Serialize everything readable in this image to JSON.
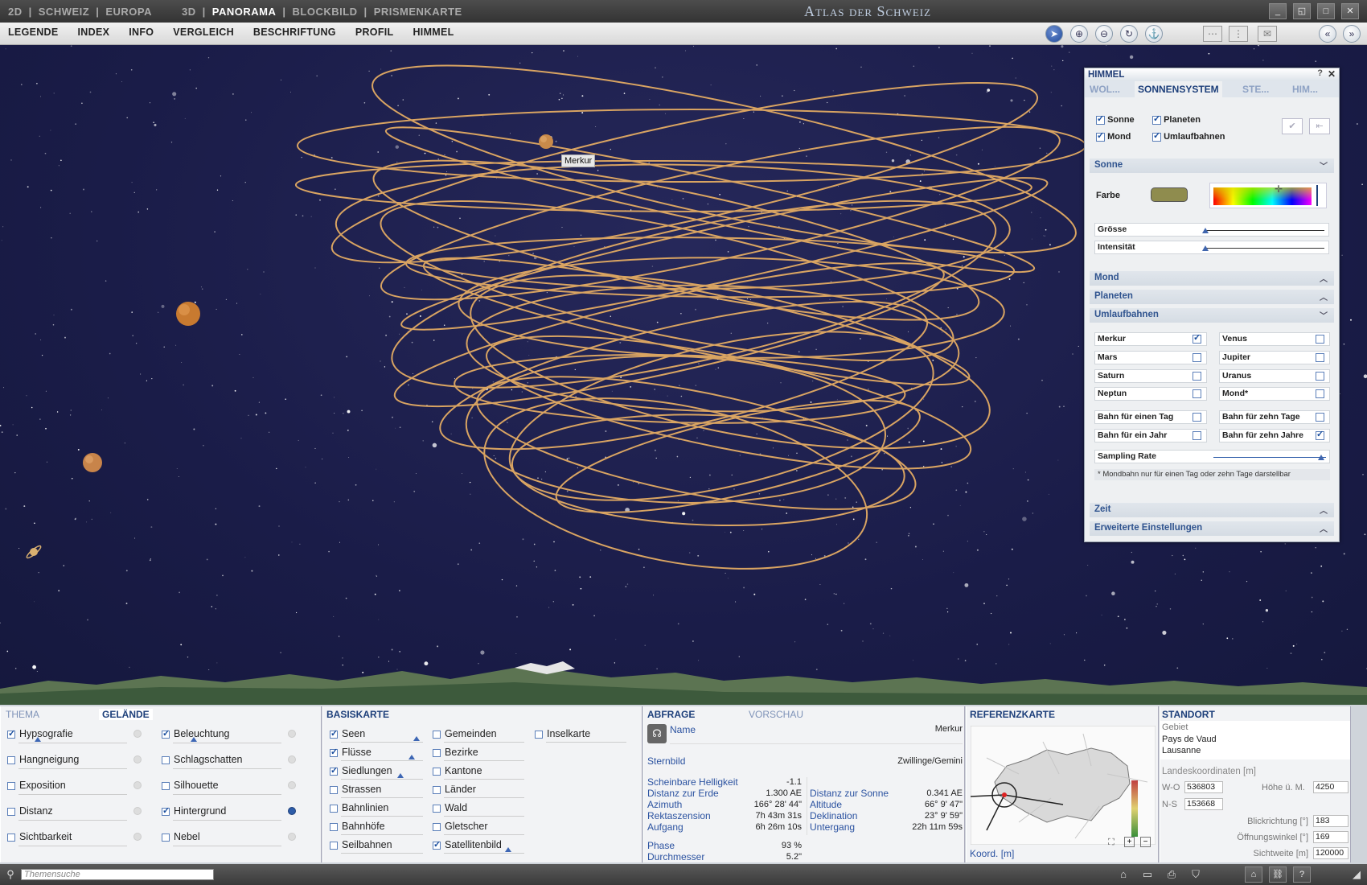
{
  "titlebar": {
    "nav_2d": [
      "2D",
      "SCHWEIZ",
      "EUROPA"
    ],
    "nav_3d": [
      "3D",
      "PANORAMA",
      "BLOCKBILD",
      "PRISMENKARTE"
    ],
    "active": "PANORAMA",
    "app_title": "Atlas der Schweiz"
  },
  "menubar": {
    "items": [
      "LEGENDE",
      "INDEX",
      "INFO",
      "VERGLEICH",
      "BESCHRIFTUNG",
      "PROFIL",
      "HIMMEL"
    ],
    "tools": [
      "pointer-icon",
      "zoom-in-icon",
      "zoom-out-icon",
      "rotate-icon",
      "viewpoint-icon"
    ]
  },
  "scene": {
    "planet_label": "Merkur"
  },
  "himmel": {
    "title": "HIMMEL",
    "tabs": [
      "WOL...",
      "SONNENSYSTEM",
      "STE...",
      "HIM..."
    ],
    "active_tab": "SONNENSYSTEM",
    "toggles": [
      {
        "label": "Sonne",
        "checked": true
      },
      {
        "label": "Planeten",
        "checked": true
      },
      {
        "label": "Mond",
        "checked": true
      },
      {
        "label": "Umlaufbahnen",
        "checked": true
      }
    ],
    "sections": {
      "sonne": "Sonne",
      "mond": "Mond",
      "planeten": "Planeten",
      "umlaufbahnen": "Umlaufbahnen",
      "zeit": "Zeit",
      "erweitert": "Erweiterte Einstellungen"
    },
    "farbe_label": "Farbe",
    "farbe_color": "#8f8c4e",
    "groesse_label": "Grösse",
    "intensitaet_label": "Intensität",
    "orbits": [
      {
        "label": "Merkur",
        "checked": true
      },
      {
        "label": "Venus",
        "checked": false
      },
      {
        "label": "Mars",
        "checked": false
      },
      {
        "label": "Jupiter",
        "checked": false
      },
      {
        "label": "Saturn",
        "checked": false
      },
      {
        "label": "Uranus",
        "checked": false
      },
      {
        "label": "Neptun",
        "checked": false
      },
      {
        "label": "Mond*",
        "checked": false
      },
      {
        "label": "Bahn für einen Tag",
        "checked": false
      },
      {
        "label": "Bahn für zehn Tage",
        "checked": false
      },
      {
        "label": "Bahn für ein Jahr",
        "checked": false
      },
      {
        "label": "Bahn für zehn Jahre",
        "checked": true
      }
    ],
    "sampling_label": "Sampling Rate",
    "note": "* Mondbahn nur für einen Tag oder zehn Tage darstellbar"
  },
  "thema": {
    "tabs": [
      "THEMA",
      "GELÄNDE"
    ],
    "active_tab": "GELÄNDE",
    "col1": [
      {
        "label": "Hypsografie",
        "checked": true
      },
      {
        "label": "Hangneigung",
        "checked": false
      },
      {
        "label": "Exposition",
        "checked": false
      },
      {
        "label": "Distanz",
        "checked": false
      },
      {
        "label": "Sichtbarkeit",
        "checked": false
      }
    ],
    "col2": [
      {
        "label": "Beleuchtung",
        "checked": true
      },
      {
        "label": "Schlagschatten",
        "checked": false
      },
      {
        "label": "Silhouette",
        "checked": false
      },
      {
        "label": "Hintergrund",
        "checked": true
      },
      {
        "label": "Nebel",
        "checked": false
      }
    ]
  },
  "basiskarte": {
    "title": "BASISKARTE",
    "col1": [
      {
        "label": "Seen",
        "checked": true
      },
      {
        "label": "Flüsse",
        "checked": true
      },
      {
        "label": "Siedlungen",
        "checked": true
      },
      {
        "label": "Strassen",
        "checked": false
      },
      {
        "label": "Bahnlinien",
        "checked": false
      },
      {
        "label": "Bahnhöfe",
        "checked": false
      },
      {
        "label": "Seilbahnen",
        "checked": false
      }
    ],
    "col2": [
      {
        "label": "Gemeinden",
        "checked": false
      },
      {
        "label": "Bezirke",
        "checked": false
      },
      {
        "label": "Kantone",
        "checked": false
      },
      {
        "label": "Länder",
        "checked": false
      },
      {
        "label": "Wald",
        "checked": false
      },
      {
        "label": "Gletscher",
        "checked": false
      },
      {
        "label": "Satellitenbild",
        "checked": true
      }
    ],
    "col3": [
      {
        "label": "Inselkarte",
        "checked": false
      }
    ]
  },
  "abfrage": {
    "tabs": [
      "ABFRAGE",
      "VORSCHAU"
    ],
    "name_key": "Name",
    "name_val": "Merkur",
    "sternbild_key": "Sternbild",
    "sternbild_val": "Zwillinge/Gemini",
    "left": [
      {
        "k": "Scheinbare Helligkeit",
        "v": "-1.1"
      },
      {
        "k": "Distanz zur Erde",
        "v": "1.300 AE"
      },
      {
        "k": "Azimuth",
        "v": "166° 28' 44\""
      },
      {
        "k": "Rektaszension",
        "v": "7h 43m 31s"
      },
      {
        "k": "Aufgang",
        "v": "6h 26m 10s"
      }
    ],
    "right": [
      {
        "k": "",
        "v": ""
      },
      {
        "k": "Distanz zur Sonne",
        "v": "0.341 AE"
      },
      {
        "k": "Altitude",
        "v": "66° 9' 47\""
      },
      {
        "k": "Deklination",
        "v": "23° 9' 59\""
      },
      {
        "k": "Untergang",
        "v": "22h 11m 59s"
      }
    ],
    "extra": [
      {
        "k": "Phase",
        "v": "93 %"
      },
      {
        "k": "Durchmesser",
        "v": "5.2\""
      }
    ]
  },
  "referenzkarte": {
    "title": "REFERENZKARTE",
    "koord_label": "Koord. [m]"
  },
  "standort": {
    "title": "STANDORT",
    "gebiet_label": "Gebiet",
    "gebiet_lines": [
      "Pays de Vaud",
      "Lausanne"
    ],
    "landeskoord_label": "Landeskoordinaten [m]",
    "wo_label": "W-O",
    "wo_val": "536803",
    "ns_label": "N-S",
    "ns_val": "153668",
    "hoehe_label": "Höhe ü. M.",
    "hoehe_val": "4250",
    "blick_label": "Blickrichtung [°]",
    "blick_val": "183",
    "oeff_label": "Öffnungswinkel [°]",
    "oeff_val": "169",
    "sicht_label": "Sichtweite [m]",
    "sicht_val": "120000"
  },
  "statusbar": {
    "search_placeholder": "Themensuche"
  }
}
